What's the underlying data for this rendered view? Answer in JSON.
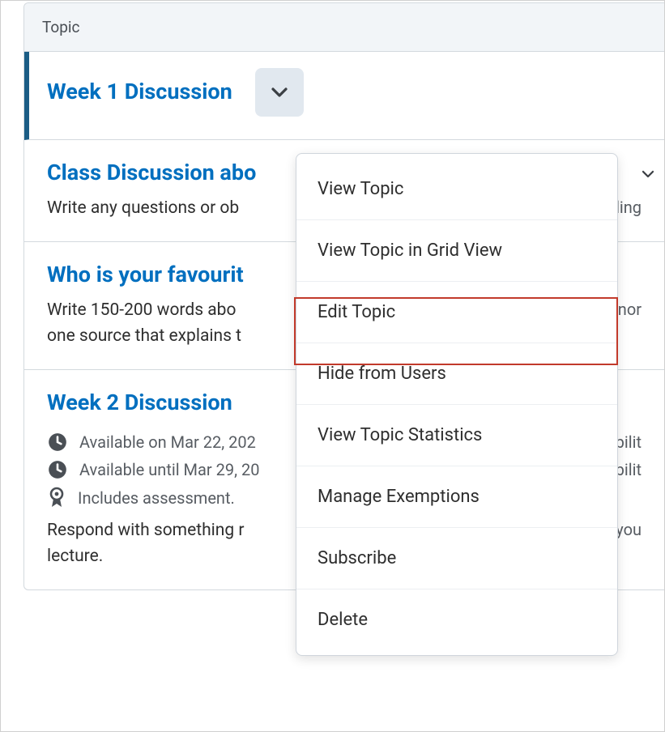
{
  "header": {
    "title": "Topic"
  },
  "topics": [
    {
      "title": "Week 1 Discussion"
    },
    {
      "title": "Class Discussion abo",
      "desc": "Write any questions or ob",
      "right": "nding"
    },
    {
      "title": "Who is your favourit",
      "desc": "Write 150-200 words abo",
      "desc2": "one source that explains t",
      "right": "ronor"
    },
    {
      "title": "Week 2 Discussion",
      "avail_from": "Available on Mar 22, 202",
      "avail_until": "Available until Mar 29, 20",
      "assessment": "Includes assessment.",
      "right1": "labilit",
      "right2": "labilit",
      "desc": "Respond with something r",
      "desc_end": "you",
      "desc2": "lecture."
    }
  ],
  "menu": {
    "items": [
      "View Topic",
      "View Topic in Grid View",
      "Edit Topic",
      "Hide from Users",
      "View Topic Statistics",
      "Manage Exemptions",
      "Subscribe",
      "Delete"
    ]
  }
}
